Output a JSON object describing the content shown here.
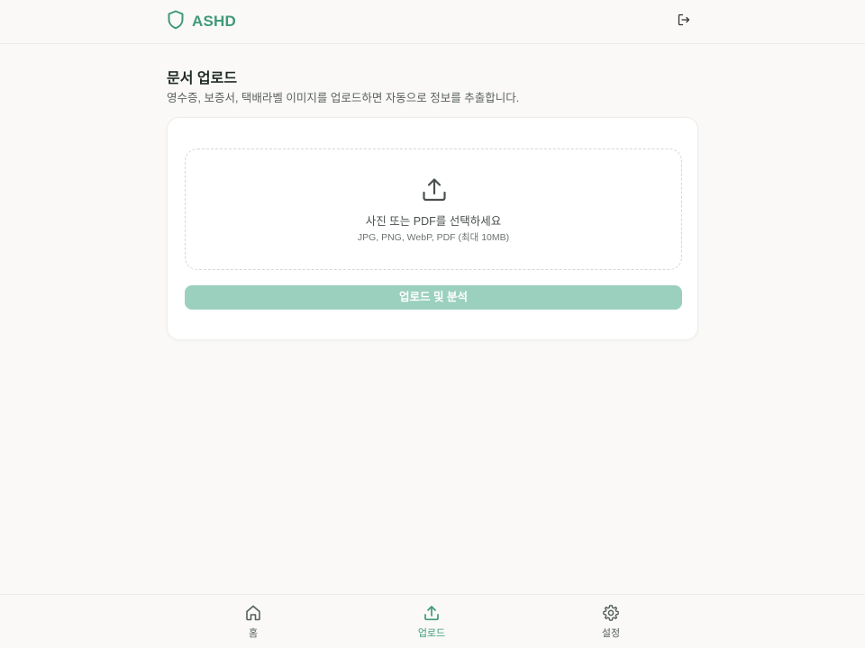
{
  "header": {
    "brand_name": "ASHD",
    "logo_icon": "shield-icon",
    "logout_icon": "logout-icon"
  },
  "page": {
    "title": "문서 업로드",
    "subtitle": "영수증, 보증서, 택배라벨 이미지를 업로드하면 자동으로 정보를 추출합니다."
  },
  "dropzone": {
    "icon": "upload-icon",
    "title": "사진 또는 PDF를 선택하세요",
    "hint": "JPG, PNG, WebP, PDF (최대 10MB)"
  },
  "upload_button": {
    "label": "업로드 및 분석",
    "enabled": false
  },
  "bottom_nav": {
    "items": [
      {
        "label": "홈",
        "icon": "home-icon",
        "active": false
      },
      {
        "label": "업로드",
        "icon": "upload-icon",
        "active": true
      },
      {
        "label": "설정",
        "icon": "gear-icon",
        "active": false
      }
    ]
  },
  "colors": {
    "accent": "#3f9a79",
    "button_disabled": "#9bd0be",
    "background": "#faf9f7",
    "card": "#ffffff"
  }
}
